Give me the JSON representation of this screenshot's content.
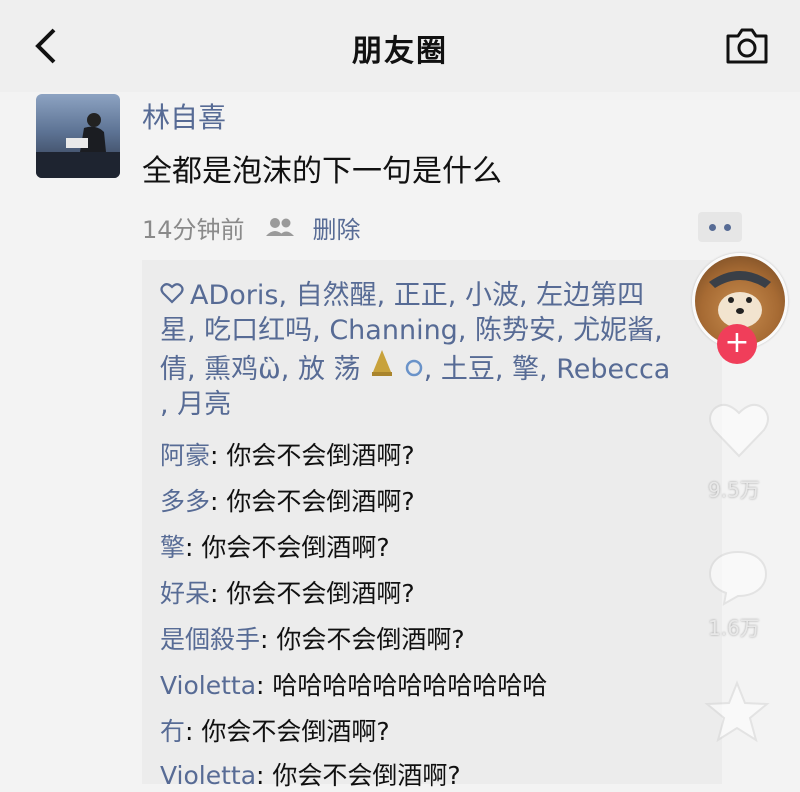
{
  "header": {
    "title": "朋友圈"
  },
  "post": {
    "author": "林自喜",
    "text": "全都是泡沫的下一句是什么",
    "time": "14分钟前",
    "delete_label": "删除"
  },
  "likes": {
    "names_line1": "ADoris, 自然醒, 正正, 小波, 左边第四",
    "names_line2": "星, 吃口红吗, Channing, 陈势安, 尤妮酱,",
    "names_line3": "倩, 熏鸡",
    "emoji_text": "ὣ, 放 荡 ",
    "tail3": ", 土豆, 擎, Rebecca",
    "names_line4": ", 月亮"
  },
  "comments": [
    {
      "name": "阿豪",
      "text": ": 你会不会倒酒啊?"
    },
    {
      "name": "多多",
      "text": ": 你会不会倒酒啊?"
    },
    {
      "name": "擎",
      "text": ": 你会不会倒酒啊?"
    },
    {
      "name": "好呆",
      "text": ": 你会不会倒酒啊?"
    },
    {
      "name": "是個殺手",
      "text": ": 你会不会倒酒啊?"
    },
    {
      "name": "Violetta",
      "text": ": 哈哈哈哈哈哈哈哈哈哈哈"
    },
    {
      "name": "冇",
      "text": ": 你会不会倒酒啊?"
    },
    {
      "name": "Violetta",
      "text": ": 你会不会倒酒啊?"
    }
  ],
  "sidebar": {
    "like_count": "9.5万",
    "comment_count": "1.6万"
  },
  "colors": {
    "link": "#576b95",
    "follow": "#f03e5a"
  },
  "icons": [
    "back-arrow-icon",
    "camera-icon",
    "people-icon",
    "more-dots-icon",
    "heart-icon",
    "comment-icon",
    "star-icon",
    "plus-icon"
  ]
}
